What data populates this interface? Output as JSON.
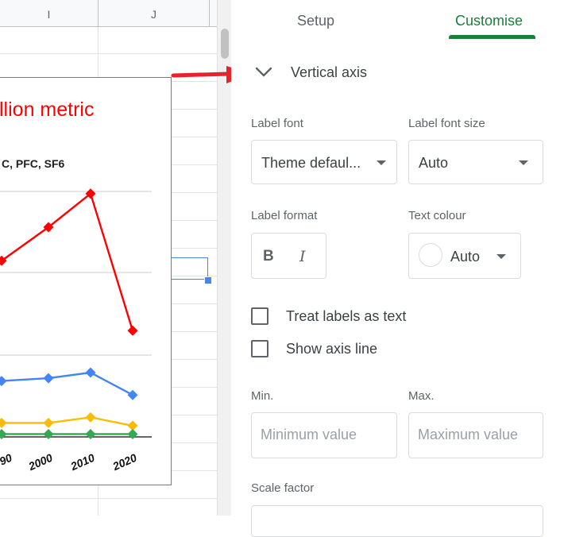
{
  "spreadsheet": {
    "column_headers": [
      "I",
      "J"
    ],
    "chart": {
      "title_fragment": "llion metric",
      "subtitle_fragment": "C, PFC, SF6",
      "x_tick_labels": [
        "90",
        "2000",
        "2010",
        "2020"
      ],
      "series_colors": [
        "#ff0000",
        "#4285f4",
        "#fbbc04",
        "#34a853"
      ]
    }
  },
  "chart_data": {
    "type": "line",
    "title": "llion metric",
    "subtitle": "C, PFC, SF6",
    "categories": [
      "90",
      "2000",
      "2010",
      "2020"
    ],
    "series": [
      {
        "values": [
          0.63,
          0.75,
          0.87,
          0.38
        ],
        "color": "#ff0000"
      },
      {
        "values": [
          0.2,
          0.21,
          0.23,
          0.15
        ],
        "color": "#4285f4"
      },
      {
        "values": [
          0.05,
          0.05,
          0.07,
          0.04
        ],
        "color": "#fbbc04"
      },
      {
        "values": [
          0.01,
          0.01,
          0.01,
          0.01
        ],
        "color": "#34a853"
      }
    ],
    "ylim": [
      0,
      1
    ],
    "grid": true
  },
  "sidebar": {
    "tabs": [
      {
        "label": "Setup"
      },
      {
        "label": "Customise"
      }
    ],
    "section_title": "Vertical axis",
    "label_font": {
      "label": "Label font",
      "value": "Theme defaul..."
    },
    "label_font_size": {
      "label": "Label font size",
      "value": "Auto"
    },
    "label_format": {
      "label": "Label format",
      "bold": "B",
      "italic": "I"
    },
    "text_colour": {
      "label": "Text colour",
      "value": "Auto"
    },
    "checkboxes": [
      {
        "label": "Treat labels as text"
      },
      {
        "label": "Show axis line"
      }
    ],
    "min": {
      "label": "Min.",
      "placeholder": "Minimum value"
    },
    "max": {
      "label": "Max.",
      "placeholder": "Maximum value"
    },
    "scale_factor": {
      "label": "Scale factor"
    }
  },
  "colors": {
    "accent": "#188038",
    "annotation_arrow": "#e8212b",
    "selection": "#4a86e8"
  }
}
